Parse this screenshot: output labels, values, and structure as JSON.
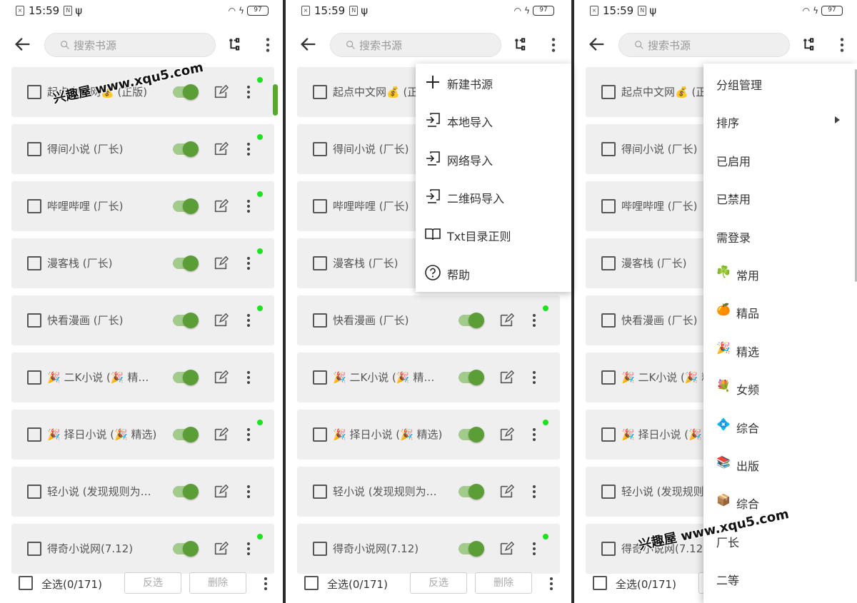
{
  "status": {
    "time": "15:59",
    "battery": "97"
  },
  "search": {
    "placeholder": "搜索书源"
  },
  "rows": [
    {
      "name": "起点中文网💰 (正版)",
      "enabled": true,
      "has_update_dot": true
    },
    {
      "name": "得间小说 (厂长)",
      "enabled": true,
      "has_update_dot": true
    },
    {
      "name": "哔哩哔哩 (厂长)",
      "enabled": true,
      "has_update_dot": true
    },
    {
      "name": "漫客栈 (厂长)",
      "enabled": true,
      "has_update_dot": true
    },
    {
      "name": "快看漫画 (厂长)",
      "enabled": true,
      "has_update_dot": true
    },
    {
      "name": "🎉 二K小说 (🎉 精…",
      "enabled": true,
      "has_update_dot": false
    },
    {
      "name": "🎉 择日小说 (🎉 精选)",
      "enabled": true,
      "has_update_dot": true
    },
    {
      "name": "轻小说 (发现规则为…",
      "enabled": true,
      "has_update_dot": false
    },
    {
      "name": "得奇小说网(7.12)",
      "enabled": true,
      "has_update_dot": true
    }
  ],
  "bottom": {
    "select_all": "全选(0/171)",
    "invert": "反选",
    "delete": "删除"
  },
  "menu_add": {
    "items": [
      {
        "label": "新建书源",
        "icon": "plus-icon"
      },
      {
        "label": "本地导入",
        "icon": "import-icon"
      },
      {
        "label": "网络导入",
        "icon": "import-icon"
      },
      {
        "label": "二维码导入",
        "icon": "import-icon"
      },
      {
        "label": "Txt目录正则",
        "icon": "book-icon"
      },
      {
        "label": "帮助",
        "icon": "help-icon"
      }
    ]
  },
  "menu_more": {
    "items": [
      {
        "label": "分组管理",
        "emoji": ""
      },
      {
        "label": "排序",
        "emoji": "",
        "submenu": true
      },
      {
        "label": "已启用",
        "emoji": ""
      },
      {
        "label": "已禁用",
        "emoji": ""
      },
      {
        "label": "需登录",
        "emoji": ""
      },
      {
        "label": "常用",
        "emoji": "☘️"
      },
      {
        "label": "精品",
        "emoji": "🍊"
      },
      {
        "label": "精选",
        "emoji": "🎉"
      },
      {
        "label": "女频",
        "emoji": "💐"
      },
      {
        "label": "综合",
        "emoji": "💠"
      },
      {
        "label": "出版",
        "emoji": "📚"
      },
      {
        "label": "综合",
        "emoji": "📦"
      },
      {
        "label": "厂长",
        "emoji": ""
      },
      {
        "label": "二等",
        "emoji": ""
      }
    ]
  },
  "watermark": "兴趣屋 www.xqu5.com",
  "colors": {
    "accent": "#5a9e35",
    "track": "#a3cc8c",
    "dot": "#1de21d",
    "row_bg": "#efefef"
  }
}
